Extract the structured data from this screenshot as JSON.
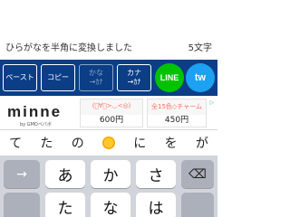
{
  "result": {
    "text": "ひらがなを半角に変換しました",
    "count": "5文字"
  },
  "toolbar": {
    "paste": "ペースト",
    "copy": "コピー",
    "kana_top": "かな",
    "kana_bottom": "→ｶﾅ",
    "kana2_top": "カナ",
    "kana2_bottom": "→ｶﾅ",
    "line": "LINE",
    "twitter": "tw",
    "colors": {
      "bar": "#0b3e86",
      "line": "#00c300",
      "twitter": "#1da1f2"
    }
  },
  "ad": {
    "logo": "minne",
    "sub": "by GMOペパボ",
    "cards": [
      {
        "title": "(ﾟ∀ﾟ>◡<◎)",
        "price": "600円"
      },
      {
        "title": "全15色◇チャーム",
        "price": "450円"
      }
    ],
    "badge": "▷"
  },
  "suggestions": [
    "て",
    "た",
    "の",
    "sun-emoji",
    "に",
    "を",
    "が"
  ],
  "keyboard": {
    "row1": [
      "→",
      "あ",
      "か",
      "さ",
      "⌫"
    ],
    "row2": [
      "",
      "た",
      "な",
      "は",
      ""
    ]
  }
}
